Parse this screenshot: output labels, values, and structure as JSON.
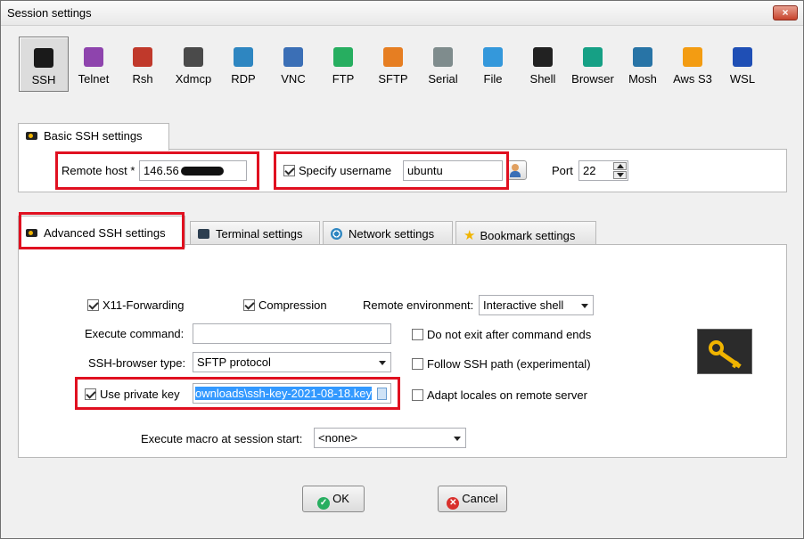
{
  "window": {
    "title": "Session settings",
    "close_icon": "×"
  },
  "protocols": [
    {
      "label": "SSH",
      "icon": "ssh-icon",
      "color": "#1a1a1a"
    },
    {
      "label": "Telnet",
      "icon": "telnet-icon",
      "color": "#8e44ad"
    },
    {
      "label": "Rsh",
      "icon": "rsh-icon",
      "color": "#c0392b"
    },
    {
      "label": "Xdmcp",
      "icon": "xdmcp-icon",
      "color": "#4a4a4a"
    },
    {
      "label": "RDP",
      "icon": "rdp-icon",
      "color": "#2e86c1"
    },
    {
      "label": "VNC",
      "icon": "vnc-icon",
      "color": "#3b6fb6"
    },
    {
      "label": "FTP",
      "icon": "ftp-icon",
      "color": "#27ae60"
    },
    {
      "label": "SFTP",
      "icon": "sftp-icon",
      "color": "#e67e22"
    },
    {
      "label": "Serial",
      "icon": "serial-icon",
      "color": "#7f8c8d"
    },
    {
      "label": "File",
      "icon": "file-icon",
      "color": "#3498db"
    },
    {
      "label": "Shell",
      "icon": "shell-icon",
      "color": "#222222"
    },
    {
      "label": "Browser",
      "icon": "browser-icon",
      "color": "#16a085"
    },
    {
      "label": "Mosh",
      "icon": "mosh-icon",
      "color": "#2874a6"
    },
    {
      "label": "Aws S3",
      "icon": "aws-s3-icon",
      "color": "#f39c12"
    },
    {
      "label": "WSL",
      "icon": "wsl-icon",
      "color": "#1f4fb5"
    }
  ],
  "basic": {
    "tab_label": "Basic SSH settings",
    "remote_host_label": "Remote host *",
    "remote_host_value": "146.56",
    "specify_username_label": "Specify username",
    "username_value": "ubuntu",
    "port_label": "Port",
    "port_value": "22"
  },
  "tabs": {
    "advanced": "Advanced SSH settings",
    "terminal": "Terminal settings",
    "network": "Network settings",
    "bookmark": "Bookmark settings"
  },
  "advanced": {
    "x11_label": "X11-Forwarding",
    "compression_label": "Compression",
    "remote_env_label": "Remote environment:",
    "remote_env_value": "Interactive shell",
    "execute_command_label": "Execute command:",
    "execute_command_value": "",
    "do_not_exit_label": "Do not exit after command ends",
    "ssh_browser_label": "SSH-browser type:",
    "ssh_browser_value": "SFTP protocol",
    "follow_ssh_label": "Follow SSH path (experimental)",
    "use_private_key_label": "Use private key",
    "private_key_value": "ownloads\\ssh-key-2021-08-18.key",
    "adapt_locales_label": "Adapt locales on remote server",
    "macro_label": "Execute macro at session start:",
    "macro_value": "<none>"
  },
  "buttons": {
    "ok": "OK",
    "cancel": "Cancel"
  },
  "colors": {
    "highlight_red": "#e01020",
    "selection_blue": "#3399ff",
    "key_gold": "#f0b400"
  }
}
